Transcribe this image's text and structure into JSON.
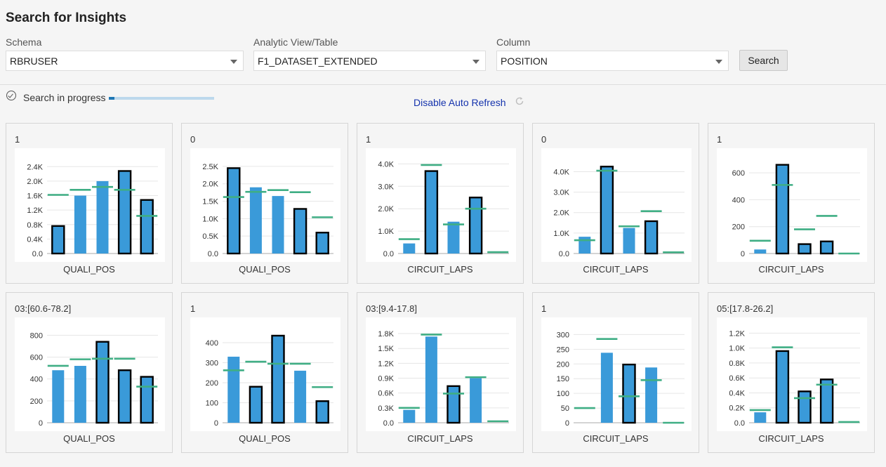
{
  "page": {
    "title": "Search for Insights"
  },
  "form": {
    "schema": {
      "label": "Schema",
      "value": "RBRUSER"
    },
    "view": {
      "label": "Analytic View/Table",
      "value": "F1_DATASET_EXTENDED"
    },
    "column": {
      "label": "Column",
      "value": "POSITION"
    },
    "search_label": "Search"
  },
  "status": {
    "text": "Search in progress",
    "progress": 0.05,
    "auto_refresh_label": "Disable Auto Refresh"
  },
  "colors": {
    "bar": "#3a9ad9",
    "bar_outline": "#000000",
    "marker": "#3fae84",
    "grid": "#e6e6e6",
    "axis": "#aaaaaa",
    "link": "#1533ad"
  },
  "chart_data": [
    {
      "type": "bar",
      "header": "1",
      "xlabel": "QUALI_POS",
      "ylim": [
        0,
        2600
      ],
      "ticks": [
        0,
        400,
        800,
        1200,
        1600,
        2000,
        2400
      ],
      "tick_labels": [
        "0.0",
        "0.4K",
        "0.8K",
        "1.2K",
        "1.6K",
        "2.0K",
        "2.4K"
      ],
      "values": [
        760,
        1600,
        2000,
        2280,
        1480
      ],
      "expected": [
        1620,
        1760,
        1840,
        1760,
        1040
      ],
      "highlighted": [
        true,
        false,
        false,
        true,
        true
      ]
    },
    {
      "type": "bar",
      "header": "0",
      "xlabel": "QUALI_POS",
      "ylim": [
        0,
        2700
      ],
      "ticks": [
        0,
        500,
        1000,
        1500,
        2000,
        2500
      ],
      "tick_labels": [
        "0.0",
        "0.5K",
        "1.0K",
        "1.5K",
        "2.0K",
        "2.5K"
      ],
      "values": [
        2450,
        1900,
        1650,
        1280,
        600
      ],
      "expected": [
        1620,
        1770,
        1820,
        1760,
        1040
      ],
      "highlighted": [
        true,
        false,
        false,
        true,
        true
      ]
    },
    {
      "type": "bar",
      "header": "1",
      "xlabel": "CIRCUIT_LAPS",
      "ylim": [
        0,
        4200
      ],
      "ticks": [
        0,
        1000,
        2000,
        3000,
        4000
      ],
      "tick_labels": [
        "0.0",
        "1.0K",
        "2.0K",
        "3.0K",
        "4.0K"
      ],
      "values": [
        450,
        3680,
        1420,
        2500,
        0
      ],
      "expected": [
        640,
        3950,
        1300,
        2000,
        60
      ],
      "highlighted": [
        false,
        true,
        false,
        true,
        false
      ]
    },
    {
      "type": "bar",
      "header": "0",
      "xlabel": "CIRCUIT_LAPS",
      "ylim": [
        0,
        4600
      ],
      "ticks": [
        0,
        1000,
        2000,
        3000,
        4000
      ],
      "tick_labels": [
        "0.0",
        "1.0K",
        "2.0K",
        "3.0K",
        "4.0K"
      ],
      "values": [
        820,
        4250,
        1250,
        1580,
        0
      ],
      "expected": [
        650,
        4050,
        1330,
        2070,
        60
      ],
      "highlighted": [
        false,
        true,
        false,
        true,
        false
      ]
    },
    {
      "type": "bar",
      "header": "1",
      "xlabel": "CIRCUIT_LAPS",
      "ylim": [
        0,
        700
      ],
      "ticks": [
        0,
        200,
        400,
        600
      ],
      "tick_labels": [
        "0",
        "200",
        "400",
        "600"
      ],
      "values": [
        30,
        660,
        70,
        90,
        0
      ],
      "expected": [
        95,
        510,
        180,
        280,
        0
      ],
      "highlighted": [
        false,
        true,
        true,
        true,
        false
      ]
    },
    {
      "type": "bar",
      "header": "03:[60.6-78.2]",
      "xlabel": "QUALI_POS",
      "ylim": [
        0,
        860
      ],
      "ticks": [
        0,
        200,
        400,
        600,
        800
      ],
      "tick_labels": [
        "0",
        "200",
        "400",
        "600",
        "800"
      ],
      "values": [
        480,
        520,
        740,
        480,
        420
      ],
      "expected": [
        520,
        580,
        585,
        585,
        330
      ],
      "highlighted": [
        false,
        false,
        true,
        true,
        true
      ]
    },
    {
      "type": "bar",
      "header": "1",
      "xlabel": "QUALI_POS",
      "ylim": [
        0,
        470
      ],
      "ticks": [
        0,
        100,
        200,
        300,
        400
      ],
      "tick_labels": [
        "0",
        "100",
        "200",
        "300",
        "400"
      ],
      "values": [
        330,
        180,
        435,
        260,
        108
      ],
      "expected": [
        262,
        305,
        295,
        295,
        178
      ],
      "highlighted": [
        false,
        true,
        true,
        false,
        true
      ]
    },
    {
      "type": "bar",
      "header": "03:[9.4-17.8]",
      "xlabel": "CIRCUIT_LAPS",
      "ylim": [
        0,
        1900
      ],
      "ticks": [
        0,
        300,
        600,
        900,
        1200,
        1500,
        1800
      ],
      "tick_labels": [
        "0.0",
        "0.3K",
        "0.6K",
        "0.9K",
        "1.2K",
        "1.5K",
        "1.8K"
      ],
      "values": [
        260,
        1740,
        740,
        900,
        0
      ],
      "expected": [
        300,
        1780,
        590,
        920,
        30
      ],
      "highlighted": [
        false,
        false,
        true,
        false,
        false
      ]
    },
    {
      "type": "bar",
      "header": "1",
      "xlabel": "CIRCUIT_LAPS",
      "ylim": [
        0,
        320
      ],
      "ticks": [
        0,
        50,
        100,
        150,
        200,
        250,
        300
      ],
      "tick_labels": [
        "0",
        "50",
        "100",
        "150",
        "200",
        "250",
        "300"
      ],
      "values": [
        0,
        238,
        198,
        188,
        0
      ],
      "expected": [
        50,
        285,
        90,
        145,
        0
      ],
      "highlighted": [
        false,
        false,
        true,
        false,
        false
      ]
    },
    {
      "type": "bar",
      "header": "05:[17.8-26.2]",
      "xlabel": "CIRCUIT_LAPS",
      "ylim": [
        0,
        1260
      ],
      "ticks": [
        0,
        200,
        400,
        600,
        800,
        1000,
        1200
      ],
      "tick_labels": [
        "0.0",
        "0.2K",
        "0.4K",
        "0.6K",
        "0.8K",
        "1.0K",
        "1.2K"
      ],
      "values": [
        140,
        960,
        420,
        580,
        0
      ],
      "expected": [
        170,
        1010,
        330,
        510,
        10
      ],
      "highlighted": [
        false,
        true,
        true,
        true,
        false
      ]
    }
  ]
}
